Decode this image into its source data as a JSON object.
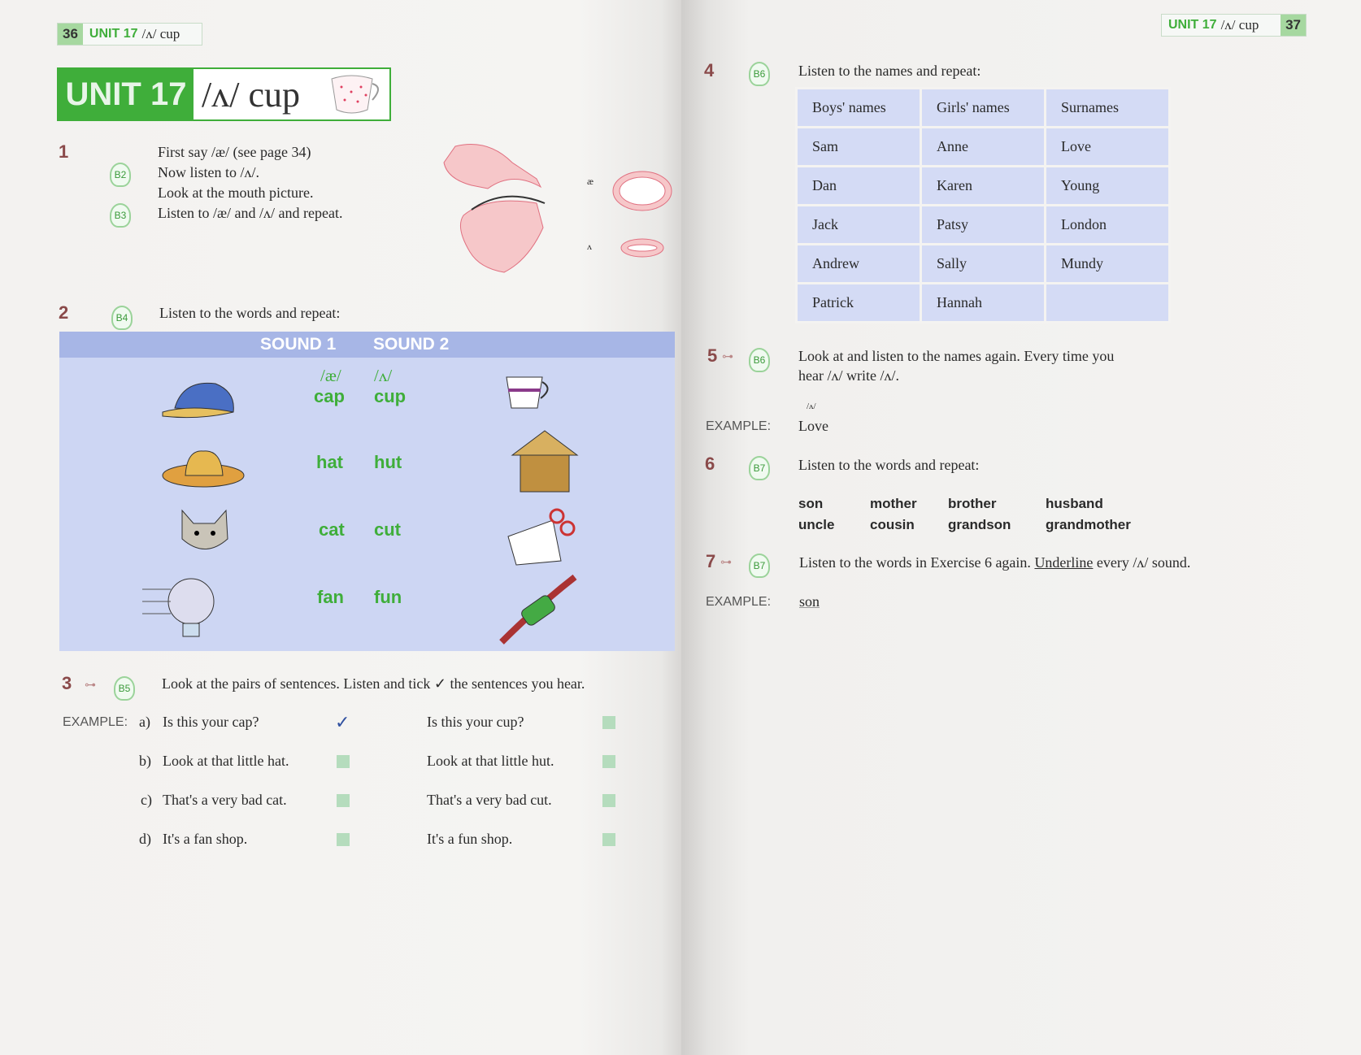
{
  "left_page": {
    "header": {
      "page_number": "36",
      "unit": "UNIT 17",
      "sound": "/ʌ/ cup"
    },
    "banner": {
      "unit": "UNIT 17",
      "title": "/ʌ/ cup"
    },
    "ex1": {
      "number": "1",
      "badges": [
        "B2",
        "B3"
      ],
      "lines": [
        "First say /æ/ (see page 34)",
        "Now listen to /ʌ/.",
        "Look at the mouth picture.",
        "Listen to /æ/ and /ʌ/ and repeat."
      ],
      "mouth_labels": [
        "æ",
        "ʌ",
        "æ",
        "ʌ"
      ]
    },
    "ex2": {
      "number": "2",
      "badge": "B4",
      "instruction": "Listen to the words and repeat:",
      "headers": [
        "SOUND 1",
        "SOUND 2"
      ],
      "phonemes": [
        "/æ/",
        "/ʌ/"
      ],
      "pairs": [
        [
          "cap",
          "cup"
        ],
        [
          "hat",
          "hut"
        ],
        [
          "cat",
          "cut"
        ],
        [
          "fan",
          "fun"
        ]
      ]
    },
    "ex3": {
      "number": "3",
      "badge": "B5",
      "instruction": "Look at the pairs of sentences. Listen and tick ✓ the sentences you hear.",
      "example_label": "EXAMPLE:",
      "rows": [
        {
          "letter": "a)",
          "s1": "Is this your cap?",
          "s1_checked": true,
          "s2": "Is this your cup?",
          "s2_checked": false
        },
        {
          "letter": "b)",
          "s1": "Look at that little hat.",
          "s1_checked": false,
          "s2": "Look at that little hut.",
          "s2_checked": false
        },
        {
          "letter": "c)",
          "s1": "That's a very bad cat.",
          "s1_checked": false,
          "s2": "That's a very bad cut.",
          "s2_checked": false
        },
        {
          "letter": "d)",
          "s1": "It's a fan shop.",
          "s1_checked": false,
          "s2": "It's a fun shop.",
          "s2_checked": false
        }
      ],
      "check_mark": "✓"
    }
  },
  "right_page": {
    "header": {
      "page_number": "37",
      "unit": "UNIT 17",
      "sound": "/ʌ/ cup"
    },
    "ex4": {
      "number": "4",
      "badge": "B6",
      "instruction": "Listen to the names and repeat:",
      "columns": [
        "Boys' names",
        "Girls' names",
        "Surnames"
      ],
      "rows": [
        [
          "Sam",
          "Anne",
          "Love"
        ],
        [
          "Dan",
          "Karen",
          "Young"
        ],
        [
          "Jack",
          "Patsy",
          "London"
        ],
        [
          "Andrew",
          "Sally",
          "Mundy"
        ],
        [
          "Patrick",
          "Hannah",
          ""
        ]
      ]
    },
    "ex5": {
      "number": "5",
      "badge": "B6",
      "lines": [
        "Look at and listen to the names again. Every time you",
        "hear /ʌ/ write  /ʌ/."
      ],
      "example_label": "EXAMPLE:",
      "example_mark": "/ʌ/",
      "example_word": "Love"
    },
    "ex6": {
      "number": "6",
      "badge": "B7",
      "instruction": "Listen to the words and repeat:",
      "words": [
        [
          "son",
          "mother",
          "brother",
          "husband"
        ],
        [
          "uncle",
          "cousin",
          "grandson",
          "grandmother"
        ]
      ]
    },
    "ex7": {
      "number": "7",
      "badge": "B7",
      "instruction_pre": "Listen to the words in Exercise 6 again. ",
      "instruction_underlined": "Underline",
      "instruction_post": " every /ʌ/ sound.",
      "example_label": "EXAMPLE:",
      "example_word": "son"
    }
  },
  "colors": {
    "green": "#3fae3a",
    "table_blue": "#d4dbf5",
    "sound_panel": "#cdd6f3",
    "number_red": "#8a4a4a"
  }
}
